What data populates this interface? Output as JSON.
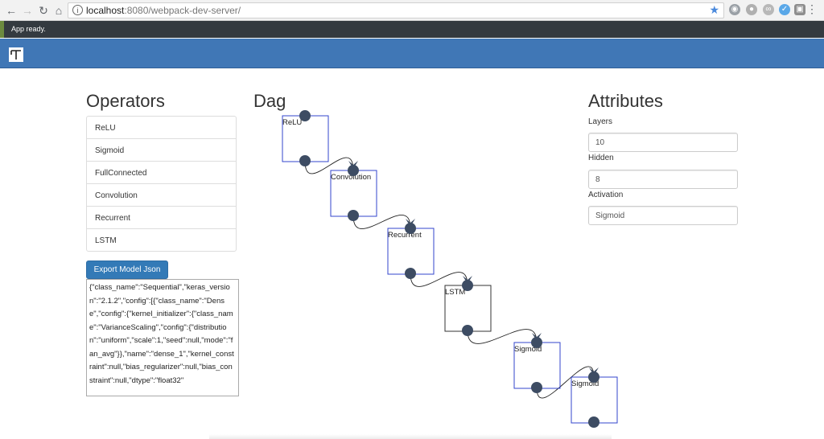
{
  "browser": {
    "url_host": "localhost",
    "url_rest": ":8080/webpack-dev-server/",
    "icons": [
      "back-icon",
      "forward-icon",
      "reload-icon",
      "home-icon",
      "info-icon",
      "star-icon",
      "menu-dots-icon"
    ]
  },
  "status": {
    "text": "App ready."
  },
  "operators": {
    "heading": "Operators",
    "items": [
      {
        "label": "ReLU"
      },
      {
        "label": "Sigmoid"
      },
      {
        "label": "FullConnected"
      },
      {
        "label": "Convolution"
      },
      {
        "label": "Recurrent"
      },
      {
        "label": "LSTM"
      }
    ],
    "export_label": "Export Model Json",
    "json_text": "{\"class_name\":\"Sequential\",\"keras_version\":\"2.1.2\",\"config\":[{\"class_name\":\"Dense\",\"config\":{\"kernel_initializer\":{\"class_name\":\"VarianceScaling\",\"config\":{\"distribution\":\"uniform\",\"scale\":1,\"seed\":null,\"mode\":\"fan_avg\"}},\"name\":\"dense_1\",\"kernel_constraint\":null,\"bias_regularizer\":null,\"bias_constraint\":null,\"dtype\":\"float32\""
  },
  "dag": {
    "heading": "Dag",
    "nodes": [
      {
        "label": "ReLU",
        "box_color": "#3344cc"
      },
      {
        "label": "Convolution",
        "box_color": "#3344cc"
      },
      {
        "label": "Recurrent",
        "box_color": "#3344cc"
      },
      {
        "label": "LSTM",
        "box_color": "#333333"
      },
      {
        "label": "Sigmoid",
        "box_color": "#3344cc"
      },
      {
        "label": "Sigmoid",
        "box_color": "#3344cc"
      }
    ],
    "port_color": "#3d4c63"
  },
  "attributes": {
    "heading": "Attributes",
    "fields": [
      {
        "label": "Layers",
        "value": "10"
      },
      {
        "label": "Hidden",
        "value": "8"
      },
      {
        "label": "Activation",
        "value": "Sigmoid"
      }
    ]
  },
  "theme": {
    "appbar_color": "#4077b6",
    "button_color": "#337ab7",
    "statusbar_color": "#343a40"
  }
}
